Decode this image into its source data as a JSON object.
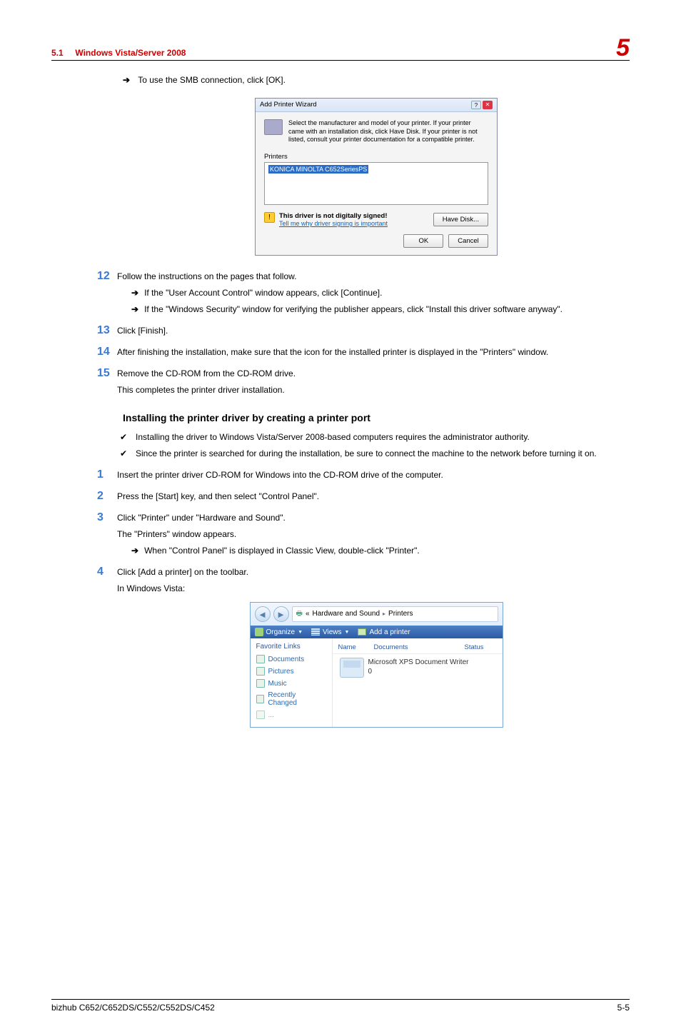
{
  "header": {
    "section": "5.1",
    "title": "Windows Vista/Server 2008",
    "page_chapter": "5"
  },
  "intro_arrow_text": "To use the SMB connection, click [OK].",
  "dialog1": {
    "title": "Add Printer Wizard",
    "desc": "Select the manufacturer and model of your printer. If your printer came with an installation disk, click Have Disk. If your printer is not listed, consult your printer documentation for a compatible printer.",
    "printers_label": "Printers",
    "printer_item": "KONICA MINOLTA C652SeriesPS",
    "warn_title": "This driver is not digitally signed!",
    "warn_link": "Tell me why driver signing is important",
    "have_disk": "Have Disk...",
    "ok": "OK",
    "cancel": "Cancel"
  },
  "step12": {
    "text": "Follow the instructions on the pages that follow.",
    "sub1": "If the \"User Account Control\" window appears, click [Continue].",
    "sub2": "If the \"Windows Security\" window for verifying the publisher appears, click \"Install this driver software anyway\"."
  },
  "step13": {
    "text": "Click [Finish]."
  },
  "step14": {
    "text": "After finishing the installation, make sure that the icon for the installed printer is displayed in the \"Printers\" window."
  },
  "step15": {
    "text": "Remove the CD-ROM from the CD-ROM drive.",
    "para": "This completes the printer driver installation."
  },
  "subsection_heading": "Installing the printer driver by creating a printer port",
  "check1": "Installing the driver to Windows Vista/Server 2008-based computers requires the administrator authority.",
  "check2": "Since the printer is searched for during the installation, be sure to connect the machine to the network before turning it on.",
  "n1": "Insert the printer driver CD-ROM for Windows into the CD-ROM drive of the computer.",
  "n2": "Press the [Start] key, and then select \"Control Panel\".",
  "n3": {
    "text": "Click \"Printer\" under \"Hardware and Sound\".",
    "para": "The \"Printers\" window appears.",
    "sub": "When \"Control Panel\" is displayed in Classic View, double-click \"Printer\"."
  },
  "n4": {
    "text": "Click [Add a printer] on the toolbar.",
    "para": "In Windows Vista:"
  },
  "explorer": {
    "breadcrumb_l1": "«",
    "breadcrumb1": "Hardware and Sound",
    "chev": "▸",
    "breadcrumb2": "Printers",
    "tb_organize": "Organize",
    "tb_views": "Views",
    "tb_add": "Add a printer",
    "fav_links": "Favorite Links",
    "side_docs": "Documents",
    "side_pics": "Pictures",
    "side_music": "Music",
    "side_recent": "Recently Changed",
    "col_name": "Name",
    "col_docs": "Documents",
    "col_status": "Status",
    "printer_name": "Microsoft XPS Document Writer",
    "printer_count": "0"
  },
  "footer": {
    "left": "bizhub C652/C652DS/C552/C552DS/C452",
    "right": "5-5"
  }
}
